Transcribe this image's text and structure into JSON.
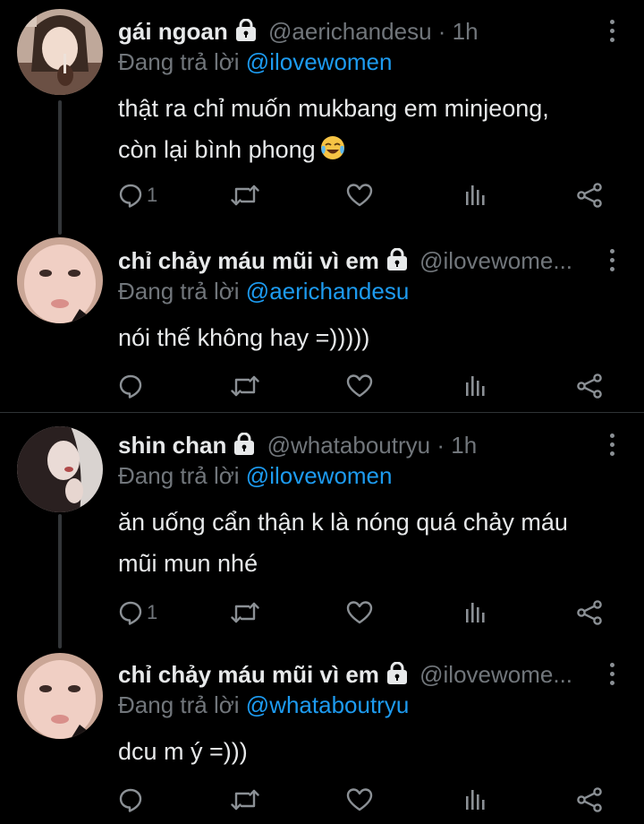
{
  "colors": {
    "background": "#000000",
    "text": "#e7e9ea",
    "muted": "#71767b",
    "link": "#1d9bf0",
    "icon": "#8b9095"
  },
  "reply_prefix": "Đang trả lời",
  "tweets": [
    {
      "display_name": "gái ngoan",
      "handle": "@aerichandesu",
      "separator": "·",
      "time": "1h",
      "reply_to": "@ilovewomen",
      "text_lines": [
        "thật ra chỉ muốn mukbang em minjeong,",
        "còn lại bình phong"
      ],
      "emoji": "face-with-tears-of-joy",
      "reply_count": "1",
      "protected": true
    },
    {
      "display_name": "chỉ chảy máu mũi vì em",
      "handle": "@ilovewome...",
      "separator": "",
      "time": "",
      "reply_to": "@aerichandesu",
      "text_lines": [
        "nói thế không hay =)))))"
      ],
      "reply_count": "",
      "protected": true
    },
    {
      "display_name": "shin chan",
      "handle": "@whataboutryu",
      "separator": "·",
      "time": "1h",
      "reply_to": "@ilovewomen",
      "text_lines": [
        "ăn uống cẩn thận k là nóng quá chảy máu",
        "mũi mun nhé"
      ],
      "reply_count": "1",
      "protected": true
    },
    {
      "display_name": "chỉ chảy máu mũi vì em",
      "handle": "@ilovewome...",
      "separator": "",
      "time": "",
      "reply_to": "@whataboutryu",
      "text_lines": [
        "dcu m ý =)))"
      ],
      "reply_count": "",
      "protected": true
    }
  ],
  "action_icons": [
    "reply-icon",
    "retweet-icon",
    "like-icon",
    "analytics-icon",
    "share-icon"
  ]
}
